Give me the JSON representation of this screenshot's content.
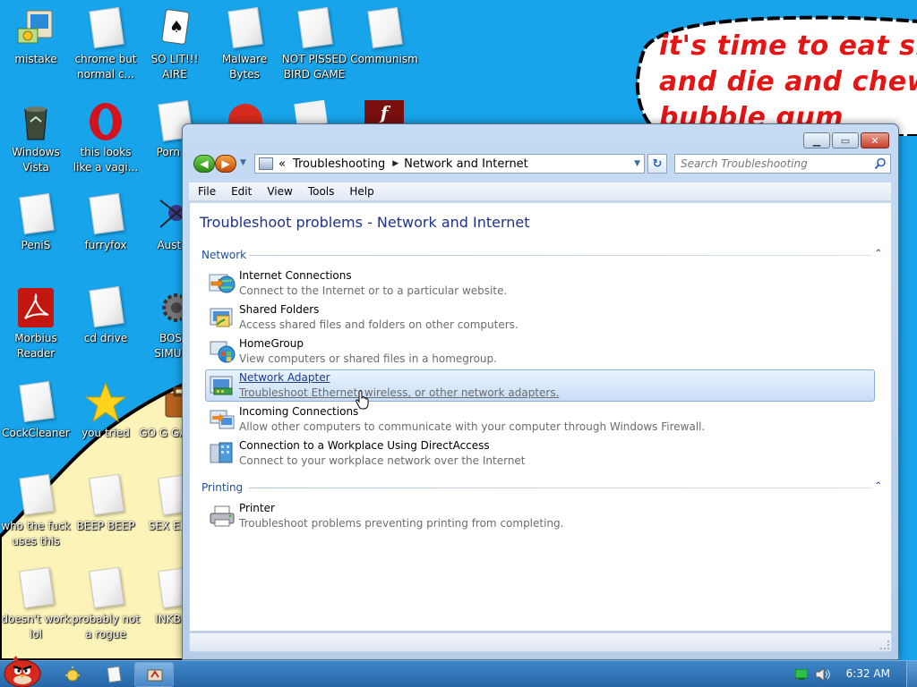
{
  "desktop": {
    "bubble_text": [
      "it's time to eat shit",
      "and die and chew",
      "bubble gum"
    ],
    "icons": [
      {
        "id": "mistake",
        "label": "mistake",
        "icon": "computer-icon"
      },
      {
        "id": "chrome",
        "label": "chrome but normal c...",
        "icon": "document-icon"
      },
      {
        "id": "solitaire",
        "label": "SO LIT!!! AIRE",
        "icon": "card-icon"
      },
      {
        "id": "malware",
        "label": "Malware Bytes",
        "icon": "document-icon"
      },
      {
        "id": "bird",
        "label": "NOT PISSED BIRD GAME",
        "icon": "document-icon"
      },
      {
        "id": "communism",
        "label": "Communism",
        "icon": "document-icon"
      },
      {
        "id": "vista",
        "label": "Windows Vista",
        "icon": "recycle-bin-icon"
      },
      {
        "id": "opera",
        "label": "this looks like a vagi...",
        "icon": "opera-icon"
      },
      {
        "id": "porn",
        "label": "Porn Pl",
        "icon": "document-icon"
      },
      {
        "id": "penis",
        "label": "PeniS",
        "icon": "document-icon"
      },
      {
        "id": "furryfox",
        "label": "furryfox",
        "icon": "document-icon"
      },
      {
        "id": "austra",
        "label": "Austra",
        "icon": "spider-icon"
      },
      {
        "id": "morbius",
        "label": "Morbius Reader",
        "icon": "pdf-icon"
      },
      {
        "id": "cddrive",
        "label": "cd drive",
        "icon": "document-icon"
      },
      {
        "id": "bosn",
        "label": "BOSN SIMULA",
        "icon": "gear-icon"
      },
      {
        "id": "cockcleaner",
        "label": "CockCleaner",
        "icon": "document-icon"
      },
      {
        "id": "youtried",
        "label": "you tried",
        "icon": "star-icon"
      },
      {
        "id": "gogadge",
        "label": "GO G GADGE",
        "icon": "briefcase-icon"
      },
      {
        "id": "whofuck",
        "label": "who the fuck uses this",
        "icon": "document-icon"
      },
      {
        "id": "beepbeep",
        "label": "BEEP BEEP",
        "icon": "document-icon"
      },
      {
        "id": "sexedit",
        "label": "SEX EDITI",
        "icon": "document-icon"
      },
      {
        "id": "doesnt",
        "label": "doesn't work lol",
        "icon": "document-icon"
      },
      {
        "id": "rogue",
        "label": "probably not a rogue",
        "icon": "document-icon"
      },
      {
        "id": "inkbal",
        "label": "INKBAL",
        "icon": "document-icon"
      }
    ]
  },
  "window": {
    "breadcrumb": [
      "Troubleshooting",
      "Network and Internet"
    ],
    "breadcrumb_prefix": "«",
    "search_placeholder": "Search Troubleshooting",
    "menu": [
      "File",
      "Edit",
      "View",
      "Tools",
      "Help"
    ],
    "page_title": "Troubleshoot problems - Network and Internet",
    "groups": [
      {
        "name": "Network",
        "items": [
          {
            "title": "Internet Connections",
            "desc": "Connect to the Internet or to a particular website.",
            "icon": "globe-network-icon"
          },
          {
            "title": "Shared Folders",
            "desc": "Access shared files and folders on other computers.",
            "icon": "shared-folder-icon"
          },
          {
            "title": "HomeGroup",
            "desc": "View computers or shared files in a homegroup.",
            "icon": "homegroup-icon"
          },
          {
            "title": "Network Adapter",
            "desc": "Troubleshoot Ethernet, wireless, or other network adapters.",
            "icon": "network-adapter-icon",
            "hover": true
          },
          {
            "title": "Incoming Connections",
            "desc": "Allow other computers to communicate with your computer through Windows Firewall.",
            "icon": "incoming-connections-icon"
          },
          {
            "title": "Connection to a Workplace Using DirectAccess",
            "desc": "Connect to your workplace network over the Internet",
            "icon": "directaccess-icon"
          }
        ]
      },
      {
        "name": "Printing",
        "items": [
          {
            "title": "Printer",
            "desc": "Troubleshoot problems preventing printing from completing.",
            "icon": "printer-icon"
          }
        ]
      }
    ]
  },
  "taskbar": {
    "clock": "6:32 AM"
  }
}
